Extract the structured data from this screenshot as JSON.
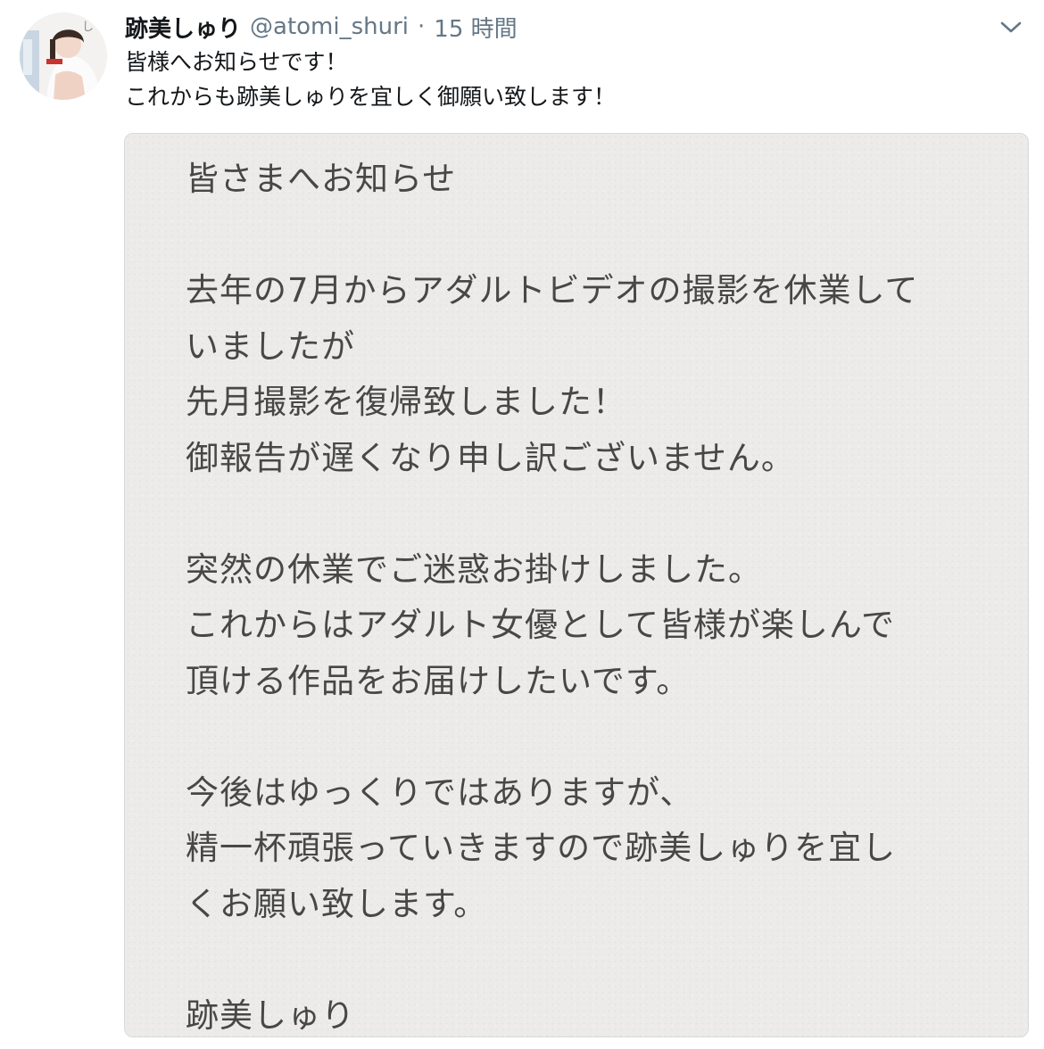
{
  "tweet": {
    "author": {
      "display_name": "跡美しゅり",
      "handle": "@atomi_shuri",
      "avatar": "profile-photo"
    },
    "separator": "·",
    "timestamp": "15 時間",
    "menu_icon": "chevron-down-icon",
    "text_lines": [
      "皆様へお知らせです！",
      "これからも跡美しゅりを宜しく御願い致します！"
    ],
    "image_note": {
      "lines": [
        "皆さまへお知らせ",
        "",
        "去年の7月からアダルトビデオの撮影を休業して",
        "いましたが",
        "先月撮影を復帰致しました！",
        "御報告が遅くなり申し訳ございません。",
        "",
        "突然の休業でご迷惑お掛けしました。",
        "これからはアダルト女優として皆様が楽しんで",
        "頂ける作品をお届けしたいです。",
        "",
        "今後はゆっくりではありますが、",
        "精一杯頑張っていきますので跡美しゅりを宜し",
        "くお願い致します。",
        "",
        "跡美しゅり"
      ]
    }
  },
  "colors": {
    "text_primary": "#14171a",
    "text_secondary": "#657786",
    "note_background": "#ecebe9",
    "note_text": "#474747"
  }
}
